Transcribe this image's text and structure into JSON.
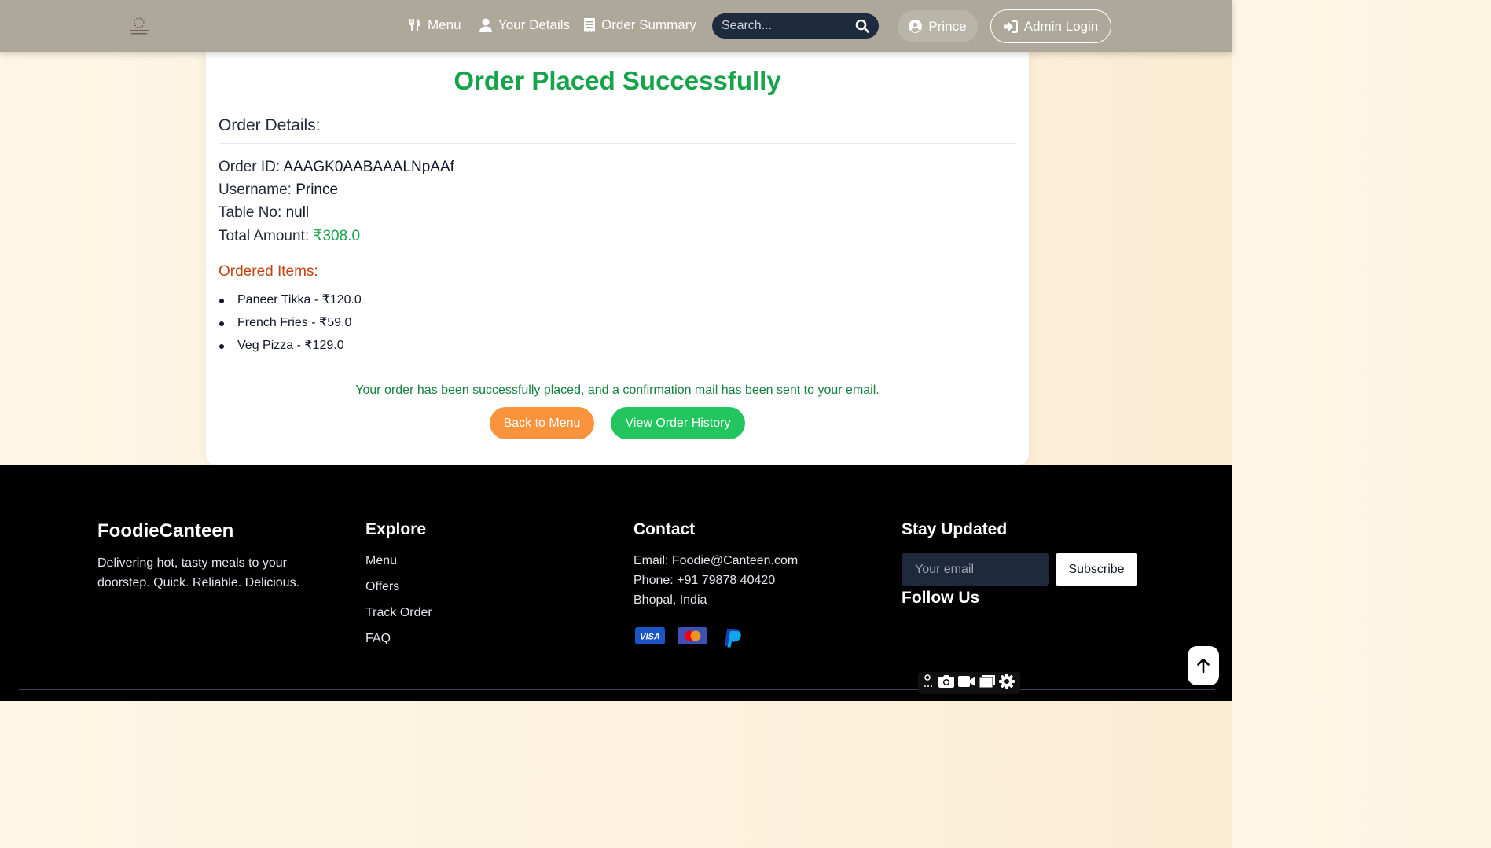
{
  "navbar": {
    "logo_icon": "canteen-logo",
    "links": [
      {
        "label": "Menu",
        "icon": "utensils-icon"
      },
      {
        "label": "Your Details",
        "icon": "user-icon"
      },
      {
        "label": "Order Summary",
        "icon": "receipt-icon"
      }
    ],
    "search": {
      "placeholder": "Search...",
      "icon": "search-icon"
    },
    "user": {
      "label": "Prince",
      "icon": "user-circle-icon"
    },
    "admin": {
      "label": "Admin Login",
      "icon": "sign-in-icon"
    }
  },
  "order": {
    "title": "Order Placed Successfully",
    "details_heading": "Order Details:",
    "order_id_label": "Order ID:",
    "order_id": "AAAGK0AABAAALNpAAf",
    "username_label": "Username:",
    "username": "Prince",
    "table_label": "Table No:",
    "table_no": "null",
    "total_label": "Total Amount:",
    "total": "₹308.0",
    "items_heading": "Ordered Items:",
    "items": [
      "Paneer Tikka - ₹120.0",
      "French Fries - ₹59.0",
      "Veg Pizza - ₹129.0"
    ],
    "confirmation": "Your order has been successfully placed, and a confirmation mail has been sent to your email.",
    "back_button": "Back to Menu",
    "history_button": "View Order History"
  },
  "footer": {
    "brand": "FoodieCanteen",
    "tagline": "Delivering hot, tasty meals to your doorstep. Quick. Reliable. Delicious.",
    "explore_title": "Explore",
    "explore_links": [
      "Menu",
      "Offers",
      "Track Order",
      "FAQ"
    ],
    "contact_title": "Contact",
    "contact_email": "Email: Foodie@Canteen.com",
    "contact_phone": "Phone: +91 79878 40420",
    "contact_location": "Bhopal, India",
    "payment_icons": [
      "visa-icon",
      "mastercard-icon",
      "paypal-icon"
    ],
    "updates_title": "Stay Updated",
    "email_placeholder": "Your email",
    "subscribe_label": "Subscribe",
    "follow_title": "Follow Us"
  },
  "colors": {
    "navbar_bg": "#aea89a",
    "success_green": "#16a34a",
    "orange_button": "#fb923c",
    "green_button": "#22c55e",
    "items_heading": "#c2410c",
    "footer_bg": "#000000"
  }
}
